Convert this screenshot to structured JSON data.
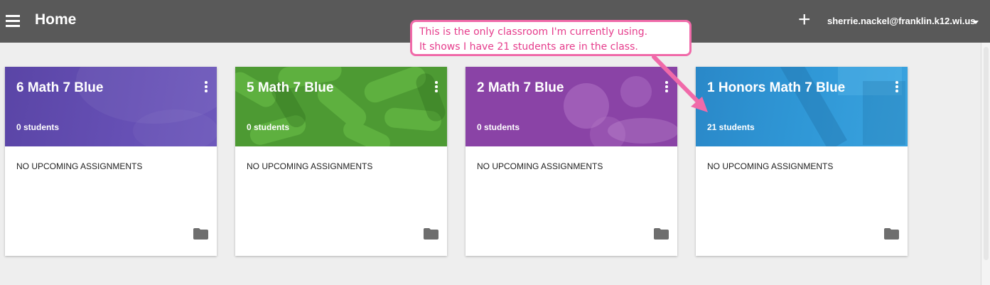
{
  "header": {
    "title": "Home",
    "add_label": "+",
    "account": "sherrie.nackel@franklin.k12.wi.us"
  },
  "callout": {
    "line1": "This is the only classroom I'm currently using.",
    "line2": "It shows I have 21 students are in the class."
  },
  "classes": [
    {
      "name": "6 Math 7 Blue",
      "students": "0 students",
      "assignments": "NO UPCOMING ASSIGNMENTS",
      "color": "#5b48a8"
    },
    {
      "name": "5 Math 7 Blue",
      "students": "0 students",
      "assignments": "NO UPCOMING ASSIGNMENTS",
      "color": "#4f9a35"
    },
    {
      "name": "2 Math 7 Blue",
      "students": "0 students",
      "assignments": "NO UPCOMING ASSIGNMENTS",
      "color": "#8e44a8"
    },
    {
      "name": "1 Honors Math 7 Blue",
      "students": "21 students",
      "assignments": "NO UPCOMING ASSIGNMENTS",
      "color": "#2a8fcf"
    }
  ],
  "icons": {
    "menu": "hamburger-icon",
    "add": "plus-icon",
    "account_menu": "caret-down-icon",
    "card_menu": "more-vert-icon",
    "folder": "folder-icon"
  }
}
